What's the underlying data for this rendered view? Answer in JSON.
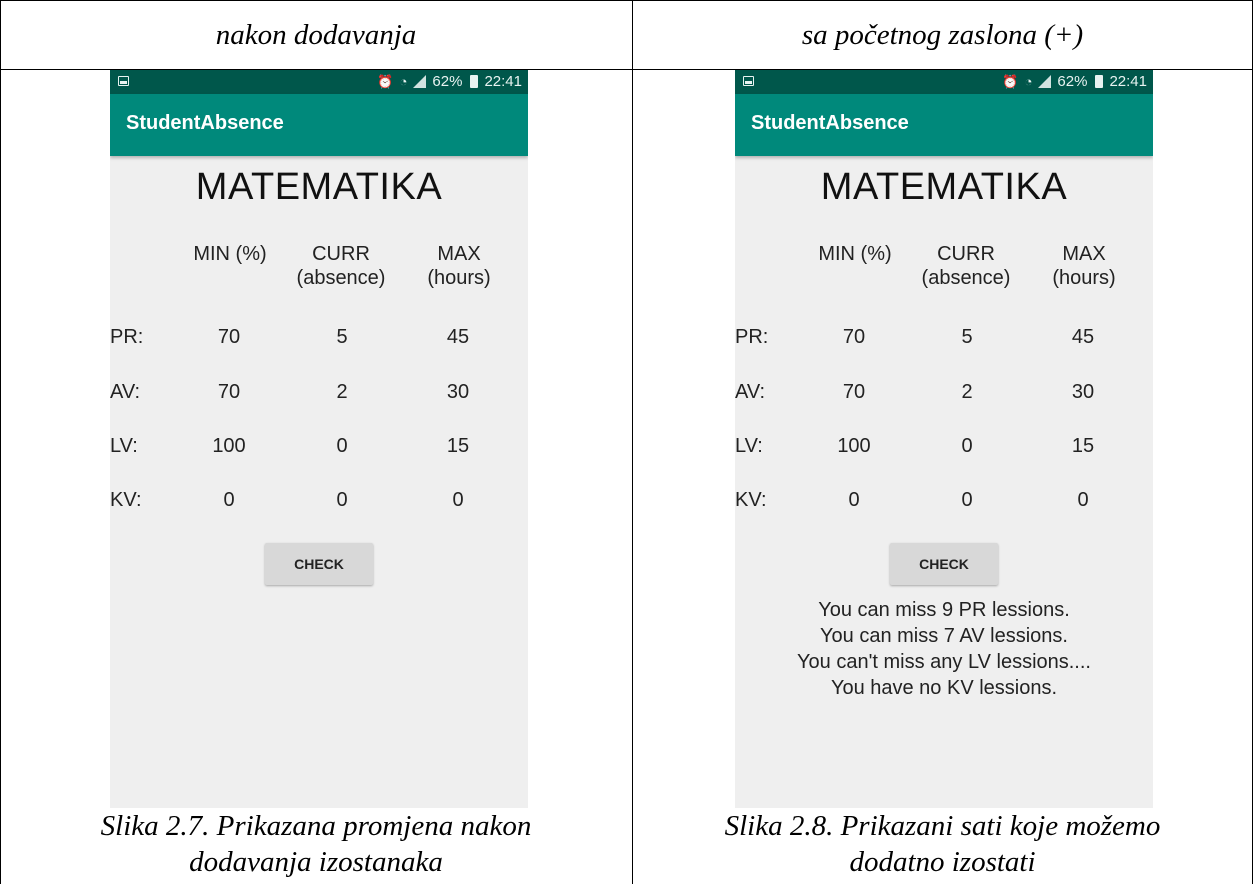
{
  "table": {
    "headers": [
      "nakon dodavanja",
      "sa početnog zaslona (+)"
    ],
    "captions": [
      [
        "Slika 2.7. Prikazana promjena nakon",
        "dodavanja izostanaka"
      ],
      [
        "Slika 2.8. Prikazani sati koje možemo",
        "dodatno izostati"
      ]
    ]
  },
  "phones": [
    {
      "status": {
        "percent": "62%",
        "time": "22:41"
      },
      "app_title": "StudentAbsence",
      "subject": "MATEMATIKA",
      "columns": [
        [
          "MIN (%)",
          ""
        ],
        [
          "CURR",
          "(absence)"
        ],
        [
          "MAX",
          "(hours)"
        ]
      ],
      "rows": [
        {
          "label": "PR:",
          "min": "70",
          "curr": "5",
          "max": "45"
        },
        {
          "label": "AV:",
          "min": "70",
          "curr": "2",
          "max": "30"
        },
        {
          "label": "LV:",
          "min": "100",
          "curr": "0",
          "max": "15"
        },
        {
          "label": "KV:",
          "min": "0",
          "curr": "0",
          "max": "0"
        }
      ],
      "button_label": "CHECK",
      "messages": []
    },
    {
      "status": {
        "percent": "62%",
        "time": "22:41"
      },
      "app_title": "StudentAbsence",
      "subject": "MATEMATIKA",
      "columns": [
        [
          "MIN (%)",
          ""
        ],
        [
          "CURR",
          "(absence)"
        ],
        [
          "MAX",
          "(hours)"
        ]
      ],
      "rows": [
        {
          "label": "PR:",
          "min": "70",
          "curr": "5",
          "max": "45"
        },
        {
          "label": "AV:",
          "min": "70",
          "curr": "2",
          "max": "30"
        },
        {
          "label": "LV:",
          "min": "100",
          "curr": "0",
          "max": "15"
        },
        {
          "label": "KV:",
          "min": "0",
          "curr": "0",
          "max": "0"
        }
      ],
      "button_label": "CHECK",
      "messages": [
        "You can miss 9 PR lessions.",
        "You can miss 7 AV lessions.",
        "You can't miss any LV lessions....",
        "You have no KV lessions."
      ]
    }
  ],
  "colors": {
    "status_bar": "#00574b",
    "app_bar": "#00897b",
    "screen_bg": "#efefef",
    "button_bg": "#d8d8d8"
  },
  "icons": [
    "image-notification-icon",
    "alarm-icon",
    "wifi-icon",
    "signal-icon",
    "battery-charging-icon"
  ]
}
